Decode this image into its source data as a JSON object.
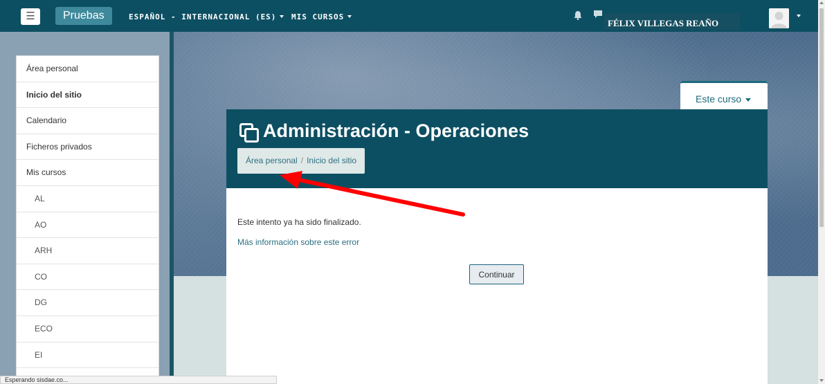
{
  "navbar": {
    "brand": "Pruebas",
    "language_menu": "ESPAÑOL - INTERNACIONAL (ES)",
    "courses_menu": "MIS CURSOS",
    "user_name": "FÉLIX VILLEGAS REAÑO",
    "icons": [
      "menu-icon",
      "bell-icon",
      "chat-icon",
      "avatar"
    ],
    "colors": {
      "navbar": "#0d4f62",
      "brand_button": "#3e8a9c"
    }
  },
  "sidebar": {
    "items": [
      {
        "label": "Área personal",
        "bold": false
      },
      {
        "label": "Inicio del sitio",
        "bold": true
      },
      {
        "label": "Calendario",
        "bold": false
      },
      {
        "label": "Ficheros privados",
        "bold": false
      },
      {
        "label": "Mis cursos",
        "bold": false
      }
    ],
    "courses": [
      "AL",
      "AO",
      "ARH",
      "CO",
      "DG",
      "ECO",
      "EI"
    ]
  },
  "course_tab": {
    "label": "Este curso"
  },
  "page": {
    "title": "Administración - Operaciones",
    "breadcrumb": [
      "Área personal",
      "Inicio del sitio"
    ],
    "message": "Este intento ya ha sido finalizado.",
    "more_info_link": "Más información sobre este error",
    "continue_button": "Continuar"
  },
  "status_bar": "Esperando sisdae.co...",
  "annotation": {
    "type": "red-arrow",
    "color": "#ff0000",
    "points_to": "breadcrumb"
  }
}
